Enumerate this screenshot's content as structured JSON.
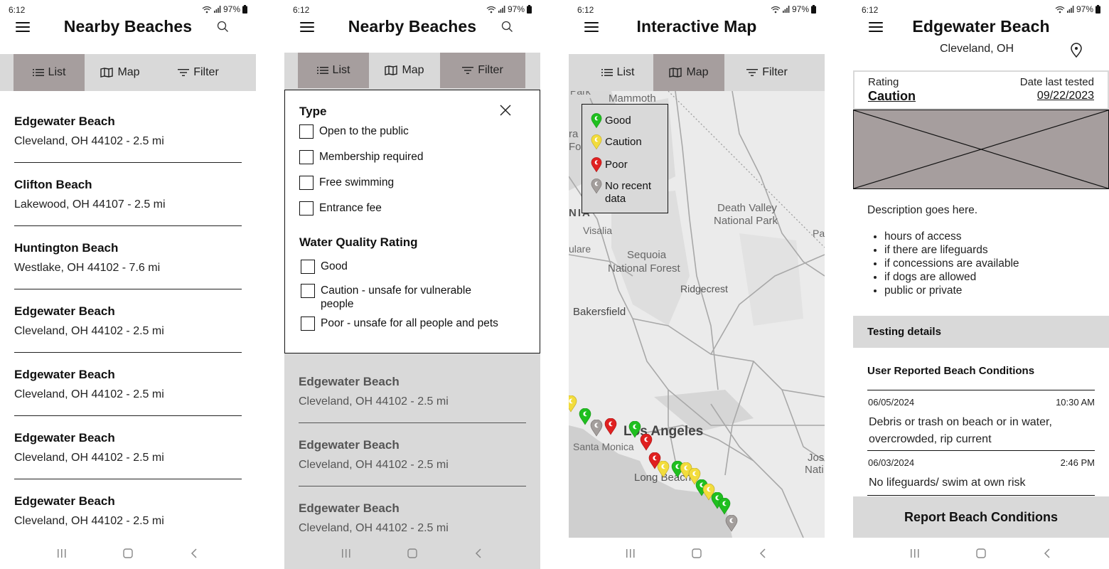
{
  "status_bar": {
    "time": "6:12",
    "battery": "97%"
  },
  "tabs": [
    {
      "label": "List",
      "icon": "list-icon"
    },
    {
      "label": "Map",
      "icon": "map-icon"
    },
    {
      "label": "Filter",
      "icon": "filter-icon"
    }
  ],
  "screen_list": {
    "title": "Nearby Beaches",
    "active_tab": "List",
    "beaches": [
      {
        "name": "Edgewater Beach",
        "address": "Cleveland, OH 44102 - 2.5 mi"
      },
      {
        "name": "Clifton Beach",
        "address": "Lakewood, OH 44107 - 2.5 mi"
      },
      {
        "name": "Huntington Beach",
        "address": "Westlake, OH 44102 - 7.6 mi"
      },
      {
        "name": "Edgewater Beach",
        "address": "Cleveland, OH 44102 - 2.5 mi"
      },
      {
        "name": "Edgewater Beach",
        "address": "Cleveland, OH 44102 - 2.5 mi"
      },
      {
        "name": "Edgewater Beach",
        "address": "Cleveland, OH 44102 - 2.5 mi"
      },
      {
        "name": "Edgewater Beach",
        "address": "Cleveland, OH 44102 - 2.5 mi"
      }
    ]
  },
  "screen_filter": {
    "title": "Nearby Beaches",
    "active_tabs": [
      "List",
      "Filter"
    ],
    "type_heading": "Type",
    "type_options": [
      {
        "label": "Open to the public",
        "checked": false
      },
      {
        "label": "Membership required",
        "checked": false
      },
      {
        "label": "Free swimming",
        "checked": false
      },
      {
        "label": "Entrance fee",
        "checked": false
      }
    ],
    "quality_heading": "Water Quality Rating",
    "quality_options": [
      {
        "label": "Good",
        "checked": false
      },
      {
        "label": "Caution - unsafe for vulnerable people",
        "checked": false
      },
      {
        "label": "Poor - unsafe for all people and pets",
        "checked": false
      }
    ],
    "beaches": [
      {
        "name": "Edgewater Beach",
        "address": "Cleveland, OH 44102 - 2.5 mi"
      },
      {
        "name": "Edgewater Beach",
        "address": "Cleveland, OH 44102 - 2.5 mi"
      },
      {
        "name": "Edgewater Beach",
        "address": "Cleveland, OH 44102 - 2.5 mi"
      }
    ]
  },
  "screen_map": {
    "title": "Interactive Map",
    "active_tab": "Map",
    "legend": [
      {
        "label": "Good",
        "color": "#1fbf1f"
      },
      {
        "label": "Caution",
        "color": "#f2dc3c"
      },
      {
        "label": "Poor",
        "color": "#e02020"
      },
      {
        "label": "No recent data",
        "color": "#a39e9c"
      }
    ],
    "place_labels": {
      "mammoth": "Mammoth",
      "park": "Park",
      "ra": "ra I",
      "fo": "Fo",
      "nia": "NIA",
      "visalia": "Visalia",
      "tulare": "ulare",
      "sequoia": "Sequoia",
      "sequoia2": "National Forest",
      "death_valley": "Death Valley",
      "death_valley2": "National Park",
      "pa": "Pa",
      "ridgecrest": "Ridgecrest",
      "bakersfield": "Bakersfield",
      "los_angeles": "Los Angeles",
      "santa_monica": "Santa Monica",
      "long_beach": "Long Beach",
      "jos": "Jos",
      "nati": "Nati"
    },
    "pins": [
      {
        "status": "caution"
      },
      {
        "status": "good"
      },
      {
        "status": "no-data"
      },
      {
        "status": "poor"
      },
      {
        "status": "good"
      },
      {
        "status": "poor"
      },
      {
        "status": "poor"
      },
      {
        "status": "caution"
      },
      {
        "status": "good"
      },
      {
        "status": "caution"
      },
      {
        "status": "caution"
      },
      {
        "status": "good"
      },
      {
        "status": "caution"
      },
      {
        "status": "good"
      },
      {
        "status": "good"
      },
      {
        "status": "no-data"
      }
    ]
  },
  "screen_detail": {
    "title": "Edgewater Beach",
    "location": "Cleveland, OH",
    "rating_label": "Rating",
    "rating_value": "Caution",
    "date_label": "Date last tested",
    "date_value": "09/22/2023",
    "description": "Description goes here.",
    "bullets": [
      "hours of access",
      "if there are lifeguards",
      "if concessions are available",
      "if dogs are allowed",
      "public or private"
    ],
    "testing_details_label": "Testing details",
    "user_reports_heading": "User Reported Beach Conditions",
    "reports": [
      {
        "date": "06/05/2024",
        "time": "10:30 AM",
        "text": "Debris or trash on beach or in water, overcrowded, rip current"
      },
      {
        "date": "06/03/2024",
        "time": "2:46 PM",
        "text": "No lifeguards/ swim at own risk"
      }
    ],
    "report_button": "Report Beach Conditions"
  },
  "colors": {
    "tab_bar": "#d9d9d9",
    "tab_active": "#a69e9e",
    "good": "#1fbf1f",
    "caution": "#f2dc3c",
    "poor": "#e02020",
    "no_data": "#a39e9c"
  }
}
